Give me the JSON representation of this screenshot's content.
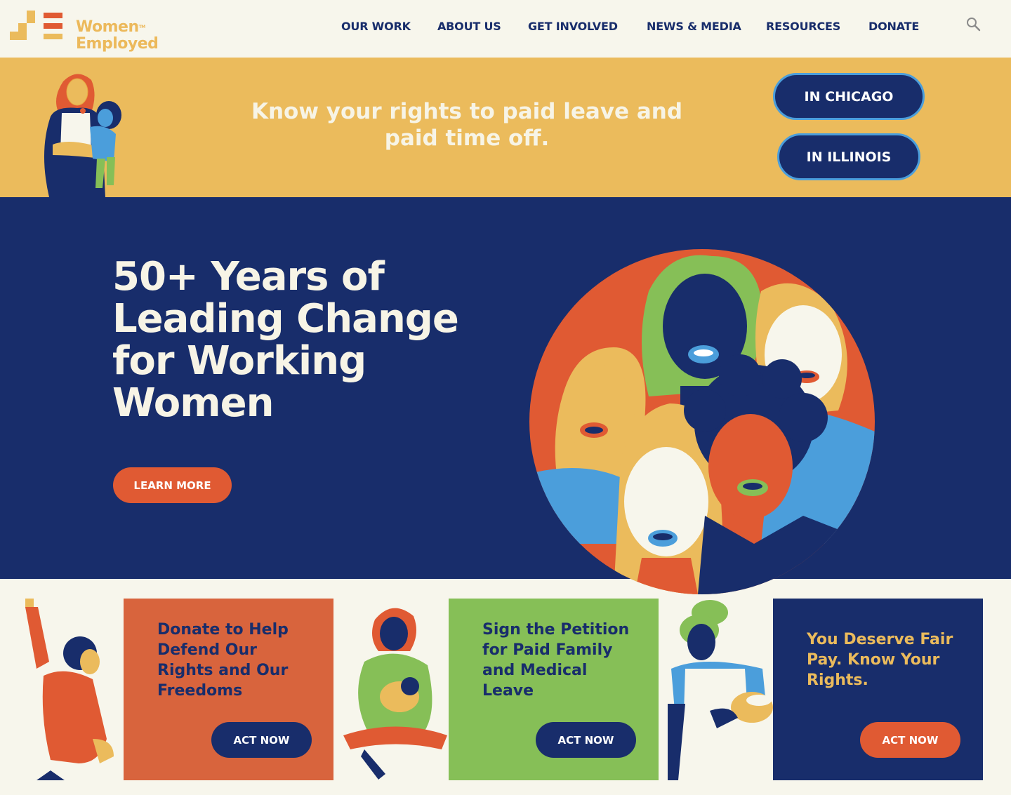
{
  "header": {
    "logo": {
      "line1": "Women",
      "line2": "Employed",
      "tm": "TM"
    },
    "nav": [
      "OUR WORK",
      "ABOUT US",
      "GET INVOLVED",
      "NEWS & MEDIA",
      "RESOURCES",
      "DONATE"
    ]
  },
  "banner": {
    "text": "Know your rights to paid leave and paid time off.",
    "buttons": [
      "IN CHICAGO",
      "IN ILLINOIS"
    ]
  },
  "hero": {
    "title": "50+ Years of Leading Change for Working Women",
    "cta": "LEARN MORE"
  },
  "cards": [
    {
      "title": "Donate to Help Defend Our Rights and Our Freedoms",
      "button": "ACT NOW"
    },
    {
      "title": "Sign the Petition for Paid Family and Medical Leave",
      "button": "ACT NOW"
    },
    {
      "title": "You Deserve Fair Pay. Know Your Rights.",
      "button": "ACT NOW"
    }
  ],
  "colors": {
    "navy": "#182d6b",
    "orange": "#e05a33",
    "gold": "#ebbb5c",
    "green": "#86bf57",
    "cream": "#f7f6ec",
    "card_orange": "#d8643d"
  },
  "icons": [
    "search-icon"
  ]
}
